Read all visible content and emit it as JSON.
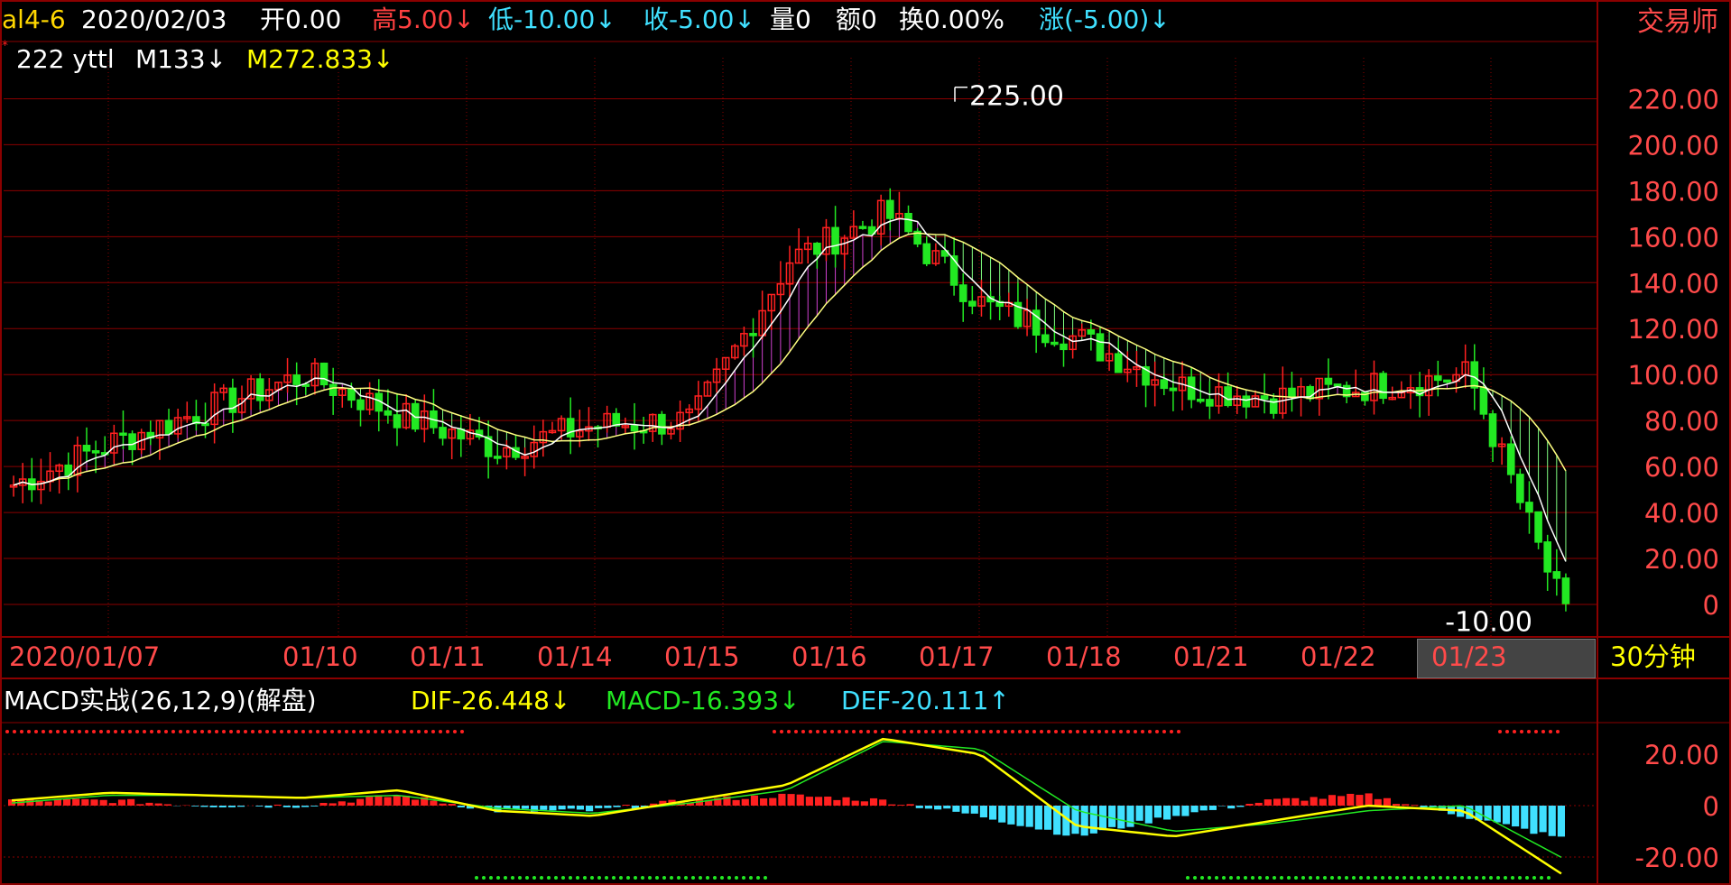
{
  "header": {
    "symbol": "al4-6",
    "date": "2020/02/03",
    "open_label": "开0.00",
    "high_label": "高5.00↓",
    "low_label": "低-10.00↓",
    "close_label": "收-5.00↓",
    "volume_label": "量0",
    "amount_label": "额0",
    "turnover_label": "换0.00%",
    "change_label": "涨(-5.00)↓",
    "brand": "交易师"
  },
  "indicator_line": {
    "name": "222 yttl",
    "m1": "M133↓",
    "m2": "M272.833↓"
  },
  "price_axis": {
    "ticks": [
      "220.00",
      "200.00",
      "180.00",
      "160.00",
      "140.00",
      "120.00",
      "100.00",
      "80.00",
      "60.00",
      "40.00",
      "20.00",
      "0"
    ],
    "tick_values": [
      220,
      200,
      180,
      160,
      140,
      120,
      100,
      80,
      60,
      40,
      20,
      0
    ],
    "high_annotation": "225.00",
    "low_annotation": "-10.00"
  },
  "date_axis": {
    "labels": [
      "2020/01/07",
      "01/10",
      "01/11",
      "01/14",
      "01/15",
      "01/16",
      "01/17",
      "01/18",
      "01/21",
      "01/22",
      "01/23"
    ],
    "highlighted": "01/23",
    "period": "30分钟"
  },
  "macd": {
    "title": "MACD实战(26,12,9)(解盘)",
    "dif_label": "DIF-26.448↓",
    "macd_label": "MACD-16.393↓",
    "def_label": "DEF-20.111↑",
    "ticks": [
      "20.00",
      "0",
      "-20.00"
    ],
    "tick_values": [
      20,
      0,
      -20
    ]
  },
  "colors": {
    "up": "#ff2020",
    "down": "#22e822",
    "grid": "#8b0000",
    "axis_text": "#ff4a4a",
    "yellow": "#ffff00",
    "cyan": "#40e0ff",
    "white": "#ffffff",
    "magenta": "#d040d0",
    "green_band": "#80ff80"
  },
  "chart_data": [
    {
      "type": "candlestick",
      "series": [
        {
          "name": "222 yttl",
          "values": []
        }
      ],
      "x": [
        "2020/01/07",
        "01/10",
        "01/11",
        "01/14",
        "01/15",
        "01/16",
        "01/17",
        "01/18",
        "01/21",
        "01/22",
        "01/23"
      ],
      "close_approx": [
        52,
        70,
        85,
        100,
        82,
        68,
        78,
        80,
        150,
        170,
        130,
        115,
        95,
        90,
        95,
        100,
        -5
      ],
      "ylim": [
        -10,
        225
      ],
      "yticks": [
        220,
        200,
        180,
        160,
        140,
        120,
        100,
        80,
        60,
        40,
        20,
        0
      ]
    },
    {
      "type": "line",
      "series": [
        {
          "name": "DIF",
          "values": [
            2,
            5,
            4,
            3,
            6,
            -2,
            -4,
            2,
            8,
            26,
            20,
            -8,
            -12,
            -6,
            0,
            -2,
            -26.448
          ]
        },
        {
          "name": "DEF",
          "values": [
            1,
            4,
            4,
            3,
            4,
            -1,
            -3,
            1,
            6,
            25,
            22,
            -2,
            -10,
            -7,
            -2,
            0,
            -20.111
          ]
        }
      ],
      "ylim": [
        -22,
        30
      ],
      "yticks": [
        20,
        0,
        -20
      ]
    }
  ]
}
